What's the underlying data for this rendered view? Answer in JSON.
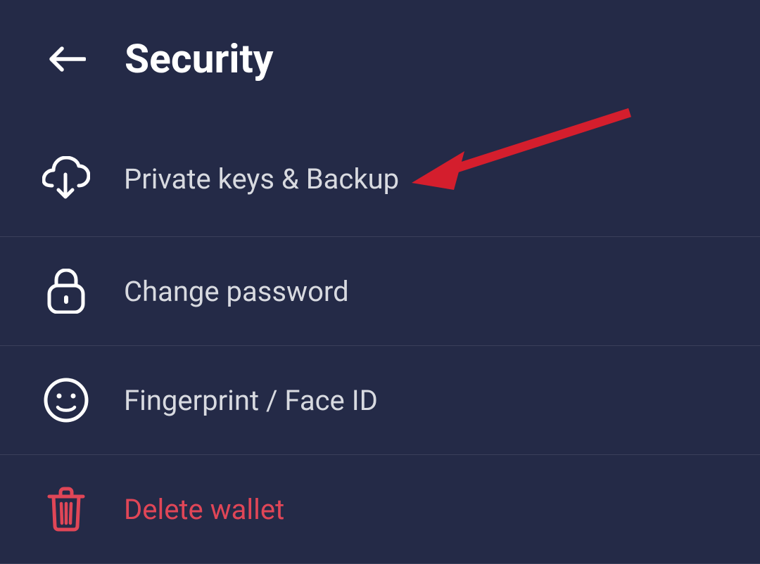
{
  "header": {
    "title": "Security"
  },
  "items": [
    {
      "label": "Private keys & Backup",
      "icon": "cloud-download-icon",
      "danger": false
    },
    {
      "label": "Change password",
      "icon": "lock-icon",
      "danger": false
    },
    {
      "label": "Fingerprint / Face ID",
      "icon": "smile-icon",
      "danger": false
    },
    {
      "label": "Delete wallet",
      "icon": "trash-icon",
      "danger": true
    }
  ],
  "colors": {
    "background": "#242a47",
    "text": "#d8dae0",
    "titleText": "#ffffff",
    "danger": "#e04657",
    "divider": "#3a3f5a",
    "arrow": "#d41e2d"
  }
}
